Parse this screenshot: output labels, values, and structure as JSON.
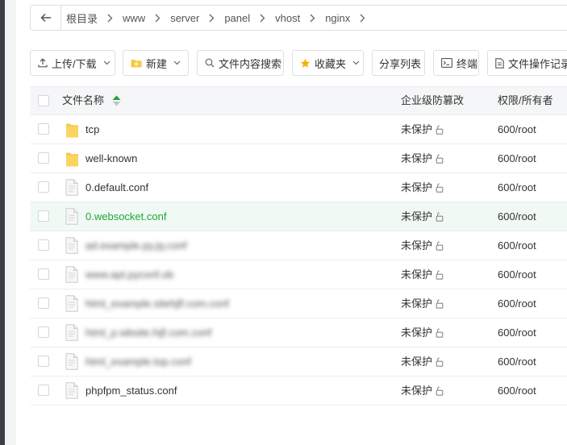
{
  "breadcrumb": [
    "根目录",
    "www",
    "server",
    "panel",
    "vhost",
    "nginx"
  ],
  "toolbar": {
    "upload": "上传/下载",
    "new": "新建",
    "search": "文件内容搜索",
    "favorites": "收藏夹",
    "share": "分享列表",
    "terminal": "终端",
    "oplog": "文件操作记录"
  },
  "table": {
    "col_name": "文件名称",
    "col_protect": "企业级防篡改",
    "col_perm": "权限/所有者",
    "rows": [
      {
        "name": "tcp",
        "type": "folder",
        "protect": "未保护",
        "perm": "600/root",
        "highlight": false,
        "obscured": false
      },
      {
        "name": "well-known",
        "type": "folder",
        "protect": "未保护",
        "perm": "600/root",
        "highlight": false,
        "obscured": false
      },
      {
        "name": "0.default.conf",
        "type": "file",
        "protect": "未保护",
        "perm": "600/root",
        "highlight": false,
        "obscured": false
      },
      {
        "name": "0.websocket.conf",
        "type": "file",
        "protect": "未保护",
        "perm": "600/root",
        "highlight": true,
        "obscured": false
      },
      {
        "name": "ad.example.py.jq.conf",
        "type": "file",
        "protect": "未保护",
        "perm": "600/root",
        "highlight": false,
        "obscured": true
      },
      {
        "name": "www.apt.pyconf.ob",
        "type": "file",
        "protect": "未保护",
        "perm": "600/root",
        "highlight": false,
        "obscured": true
      },
      {
        "name": "html_example.sitehjlf.com.conf",
        "type": "file",
        "protect": "未保护",
        "perm": "600/root",
        "highlight": false,
        "obscured": true
      },
      {
        "name": "html_p.wbsite.hijf.com.conf",
        "type": "file",
        "protect": "未保护",
        "perm": "600/root",
        "highlight": false,
        "obscured": true
      },
      {
        "name": "html_example.top.conf",
        "type": "file",
        "protect": "未保护",
        "perm": "600/root",
        "highlight": false,
        "obscured": true
      },
      {
        "name": "phpfpm_status.conf",
        "type": "file",
        "protect": "未保护",
        "perm": "600/root",
        "highlight": false,
        "obscured": false
      }
    ]
  },
  "colors": {
    "accent": "#20a53a",
    "folder": "#f7c948",
    "border": "#dcdfe6",
    "highlight_row": "#f0f9f3"
  }
}
